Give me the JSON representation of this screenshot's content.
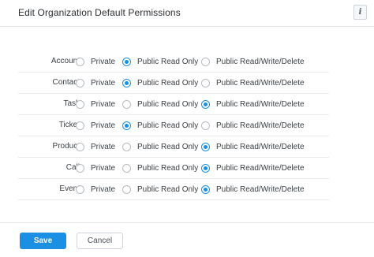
{
  "dialog": {
    "title": "Edit Organization Default Permissions",
    "info_icon": "info-icon",
    "info_label": "i"
  },
  "options": [
    "Private",
    "Public Read Only",
    "Public Read/Write/Delete"
  ],
  "rows": [
    {
      "entity": "Accounts",
      "selected": "Public Read Only"
    },
    {
      "entity": "Contacts",
      "selected": "Public Read Only"
    },
    {
      "entity": "Tasks",
      "selected": "Public Read/Write/Delete"
    },
    {
      "entity": "Tickets",
      "selected": "Public Read Only"
    },
    {
      "entity": "Products",
      "selected": "Public Read/Write/Delete"
    },
    {
      "entity": "Calls",
      "selected": "Public Read/Write/Delete"
    },
    {
      "entity": "Events",
      "selected": "Public Read/Write/Delete"
    }
  ],
  "footer": {
    "save_label": "Save",
    "cancel_label": "Cancel"
  },
  "colors": {
    "accent": "#1a8fe3"
  }
}
